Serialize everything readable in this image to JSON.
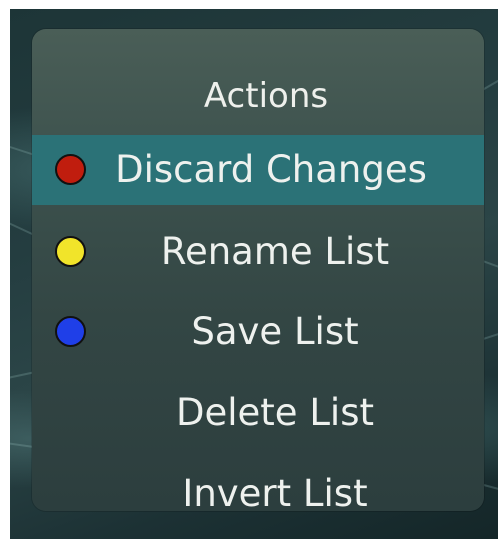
{
  "menu": {
    "title": "Actions",
    "items": [
      {
        "label": "Discard Changes",
        "color_key": "red",
        "color_hex": "#c01d0e",
        "selected": true
      },
      {
        "label": "Rename List",
        "color_key": "yellow",
        "color_hex": "#f1e42a",
        "selected": false
      },
      {
        "label": "Save List",
        "color_key": "blue",
        "color_hex": "#1f3fe8",
        "selected": false
      },
      {
        "label": "Delete List",
        "color_key": "",
        "selected": false
      },
      {
        "label": "Invert List",
        "color_key": "",
        "selected": false
      }
    ]
  },
  "colors": {
    "selected_highlight": "#2b7277",
    "panel": "#3c514d",
    "text": "#eef1ee"
  }
}
